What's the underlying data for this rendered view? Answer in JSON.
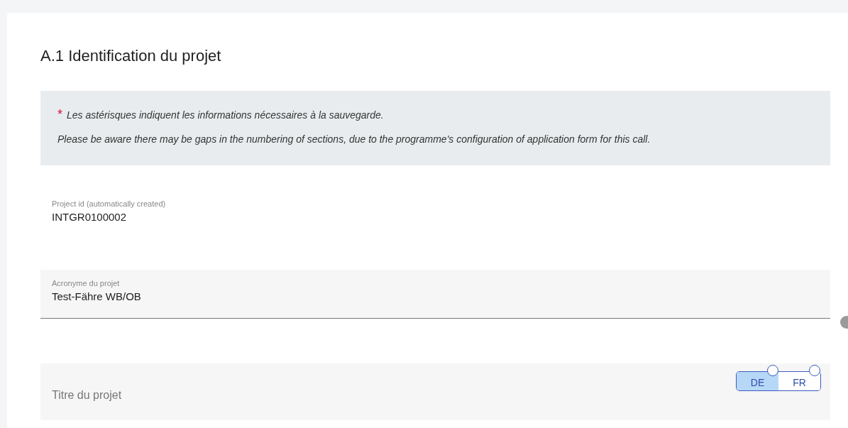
{
  "section": {
    "title": "A.1 Identification du projet"
  },
  "notice": {
    "required_mark": "*",
    "lines": [
      "Les astérisques indiquent les informations nécessaires à la sauvegarde.",
      "Please be aware there may be gaps in the numbering of sections, due to the programme's configuration of application form for this call."
    ]
  },
  "fields": [
    {
      "kind": "readonly",
      "label": "Project id (automatically created)",
      "value": "INTGR0100002"
    },
    {
      "kind": "input",
      "label": "Acronyme du projet",
      "value": "Test-Fähre WB/OB"
    }
  ],
  "language_toggle": [
    {
      "label": "DE",
      "selected": true
    },
    {
      "label": "FR",
      "selected": false
    }
  ],
  "title_field": {
    "placeholder": "Titre du projet"
  }
}
